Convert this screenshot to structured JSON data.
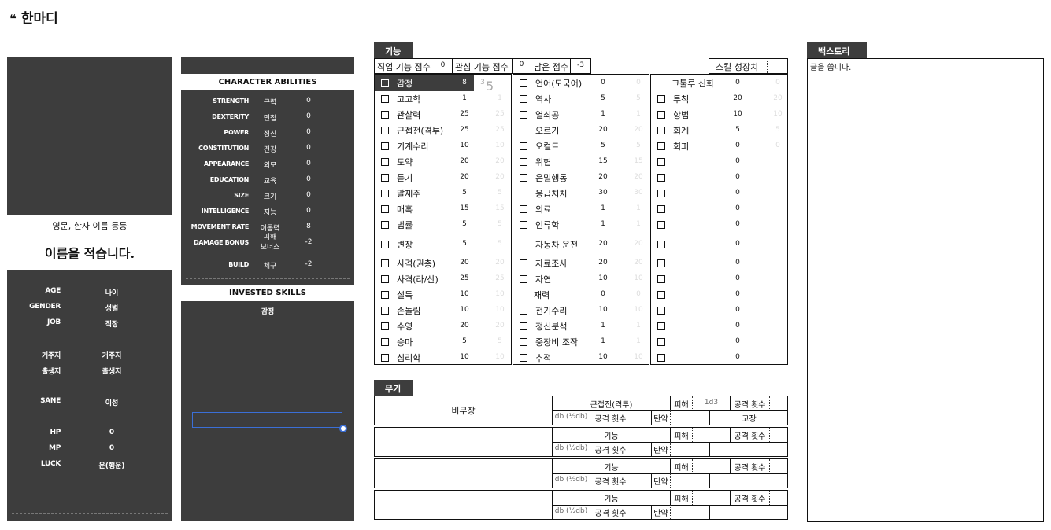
{
  "title": "한마디",
  "profile": {
    "name_hint": "영문, 한자 이름 등등",
    "name": "이름을 적습니다.",
    "fields": [
      {
        "key": "AGE",
        "value": "나이"
      },
      {
        "key": "GENDER",
        "value": "성별"
      },
      {
        "key": "JOB",
        "value": "직장"
      },
      {
        "key": "거주지",
        "value": "거주지"
      },
      {
        "key": "출생지",
        "value": "출생지"
      },
      {
        "key": "SANE",
        "value": "이성"
      },
      {
        "key": "HP",
        "value": "0"
      },
      {
        "key": "MP",
        "value": "0"
      },
      {
        "key": "LUCK",
        "value": "운(행운)"
      }
    ]
  },
  "abilities": {
    "title": "CHARACTER ABILITIES",
    "rows": [
      {
        "en": "STRENGTH",
        "ko": "근력",
        "value": "0"
      },
      {
        "en": "DEXTERITY",
        "ko": "민첩",
        "value": "0"
      },
      {
        "en": "POWER",
        "ko": "정신",
        "value": "0"
      },
      {
        "en": "CONSTITUTION",
        "ko": "건강",
        "value": "0"
      },
      {
        "en": "APPEARANCE",
        "ko": "외모",
        "value": "0"
      },
      {
        "en": "EDUCATION",
        "ko": "교육",
        "value": "0"
      },
      {
        "en": "SIZE",
        "ko": "크기",
        "value": "0"
      },
      {
        "en": "INTELLIGENCE",
        "ko": "지능",
        "value": "0"
      },
      {
        "en": "MOVEMENT RATE",
        "ko": "이동력",
        "value": "8"
      },
      {
        "en": "DAMAGE BONUS",
        "ko": "피해\n보너스",
        "value": "-2"
      },
      {
        "en": "BUILD",
        "ko": "체구",
        "value": "-2"
      }
    ]
  },
  "invested": {
    "title": "INVESTED SKILLS",
    "items": [
      "감정"
    ]
  },
  "skills_tab": "기능",
  "skill_header": {
    "job_label": "직업 기능 점수",
    "job_value": "0",
    "interest_label": "관심 기능 점수",
    "interest_value": "0",
    "remain_label": "남은 점수",
    "remain_value": "-3",
    "growth_label": "스킬 성장치"
  },
  "skills_col1": [
    {
      "name": "감정",
      "value": "8",
      "a": "3",
      "b": "5"
    },
    {
      "name": "고고학",
      "value": "1",
      "a": "1"
    },
    {
      "name": "관찰력",
      "value": "25",
      "a": "25"
    },
    {
      "name": "근접전(격투)",
      "value": "25",
      "a": "25"
    },
    {
      "name": "기계수리",
      "value": "10",
      "a": "10"
    },
    {
      "name": "도약",
      "value": "20",
      "a": "20"
    },
    {
      "name": "듣기",
      "value": "20",
      "a": "20"
    },
    {
      "name": "말재주",
      "value": "5",
      "a": "5"
    },
    {
      "name": "매혹",
      "value": "15",
      "a": "15"
    },
    {
      "name": "법률",
      "value": "5",
      "a": "5"
    },
    {
      "name": "변장",
      "value": "5",
      "a": "5"
    },
    {
      "name": "사격(권총)",
      "value": "20",
      "a": "20"
    },
    {
      "name": "사격(라/산)",
      "value": "25",
      "a": "25"
    },
    {
      "name": "설득",
      "value": "10",
      "a": "10"
    },
    {
      "name": "손놀림",
      "value": "10",
      "a": "10"
    },
    {
      "name": "수영",
      "value": "20",
      "a": "20"
    },
    {
      "name": "승마",
      "value": "5",
      "a": "5"
    },
    {
      "name": "심리학",
      "value": "10",
      "a": "10"
    }
  ],
  "skills_col2": [
    {
      "name": "언어(모국어)",
      "value": "0",
      "a": "0"
    },
    {
      "name": "역사",
      "value": "5",
      "a": "5"
    },
    {
      "name": "열쇠공",
      "value": "1",
      "a": "1"
    },
    {
      "name": "오르기",
      "value": "20",
      "a": "20"
    },
    {
      "name": "오컬트",
      "value": "5",
      "a": "5"
    },
    {
      "name": "위협",
      "value": "15",
      "a": "15"
    },
    {
      "name": "은밀행동",
      "value": "20",
      "a": "20"
    },
    {
      "name": "응급처치",
      "value": "30",
      "a": "30"
    },
    {
      "name": "의료",
      "value": "1",
      "a": "1"
    },
    {
      "name": "인류학",
      "value": "1",
      "a": "1"
    },
    {
      "name": "자동차 운전",
      "value": "20",
      "a": "20"
    },
    {
      "name": "자료조사",
      "value": "20",
      "a": "20"
    },
    {
      "name": "자연",
      "value": "10",
      "a": "10"
    },
    {
      "name": "재력",
      "value": "0",
      "a": "0",
      "nocb": true
    },
    {
      "name": "전기수리",
      "value": "10",
      "a": "10"
    },
    {
      "name": "정신분석",
      "value": "1",
      "a": "1"
    },
    {
      "name": "중장비 조작",
      "value": "1",
      "a": "1"
    },
    {
      "name": "추적",
      "value": "10",
      "a": "10"
    }
  ],
  "skills_col3": [
    {
      "name": "크툴루 신화",
      "value": "0",
      "a": "0",
      "nocb": true
    },
    {
      "name": "투척",
      "value": "20",
      "a": "20"
    },
    {
      "name": "항법",
      "value": "10",
      "a": "10"
    },
    {
      "name": "회계",
      "value": "5",
      "a": "5"
    },
    {
      "name": "회피",
      "value": "0",
      "a": "0"
    },
    {
      "name": "",
      "value": "0"
    },
    {
      "name": "",
      "value": "0"
    },
    {
      "name": "",
      "value": "0"
    },
    {
      "name": "",
      "value": "0"
    },
    {
      "name": "",
      "value": "0"
    },
    {
      "name": "",
      "value": "0"
    },
    {
      "name": "",
      "value": "0"
    },
    {
      "name": "",
      "value": "0"
    },
    {
      "name": "",
      "value": "0"
    },
    {
      "name": "",
      "value": "0"
    },
    {
      "name": "",
      "value": "0"
    },
    {
      "name": "",
      "value": "0"
    },
    {
      "name": "",
      "value": "0"
    }
  ],
  "weapons_tab": "무기",
  "weapons": [
    {
      "name": "비무장",
      "skill": "근접전(격투)",
      "damage_label": "피해",
      "damage": "1d3",
      "attacks_label": "공격 횟수",
      "db": "db (½db)",
      "attacks_label2": "공격 횟수",
      "ammo_label": "탄약",
      "malf": "고장"
    },
    {
      "name": "",
      "skill": "기능",
      "damage_label": "피해",
      "damage": "",
      "attacks_label": "공격 횟수",
      "db": "db (½db)",
      "attacks_label2": "공격 횟수",
      "ammo_label": "탄약",
      "malf": ""
    },
    {
      "name": "",
      "skill": "기능",
      "damage_label": "피해",
      "damage": "",
      "attacks_label": "공격 횟수",
      "db": "db (½db)",
      "attacks_label2": "공격 횟수",
      "ammo_label": "탄약",
      "malf": ""
    },
    {
      "name": "",
      "skill": "기능",
      "damage_label": "피해",
      "damage": "",
      "attacks_label": "공격 횟수",
      "db": "db (½db)",
      "attacks_label2": "공격 횟수",
      "ammo_label": "탄약",
      "malf": ""
    }
  ],
  "backstory": {
    "tab": "백스토리",
    "text": "글을 씁니다."
  }
}
